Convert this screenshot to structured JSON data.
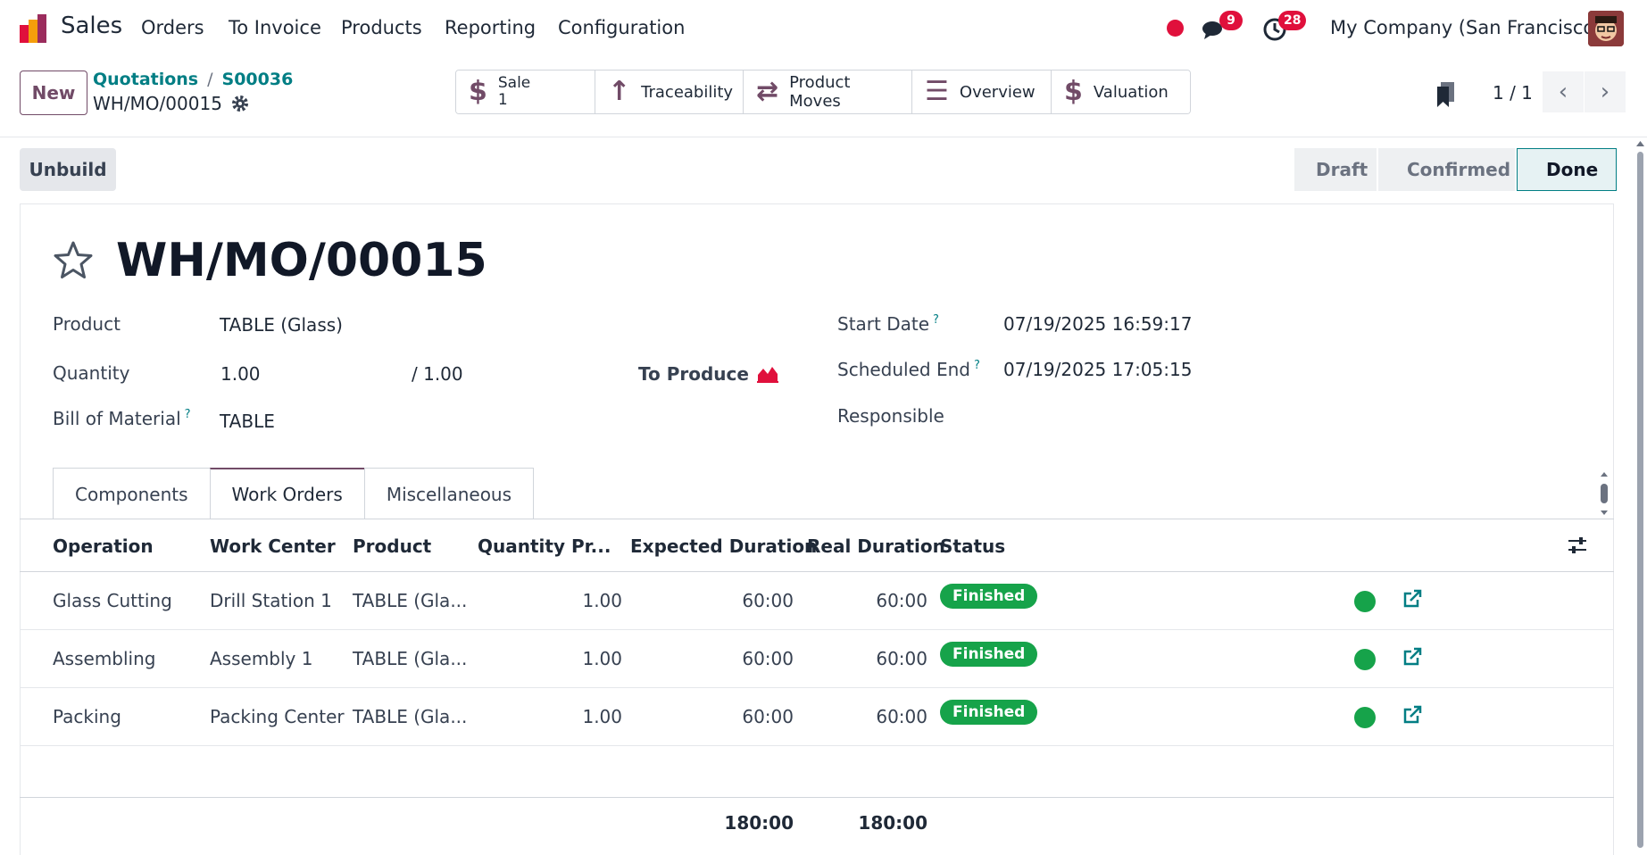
{
  "nav": {
    "app_name": "Sales",
    "menu": [
      "Orders",
      "To Invoice",
      "Products",
      "Reporting",
      "Configuration"
    ],
    "messages_count": "9",
    "activities_count": "28",
    "company": "My Company (San Francisco)"
  },
  "control": {
    "new_label": "New",
    "breadcrumb": [
      "Quotations",
      "S00036"
    ],
    "record_name": "WH/MO/00015",
    "smart_buttons": {
      "sale_label": "Sale",
      "sale_count": "1",
      "traceability": "Traceability",
      "product_moves": "Product Moves",
      "overview": "Overview",
      "valuation": "Valuation"
    },
    "pager": "1 / 1"
  },
  "status": {
    "unbuild_label": "Unbuild",
    "stages": [
      "Draft",
      "Confirmed",
      "Done"
    ],
    "active_stage": "Done"
  },
  "form": {
    "title": "WH/MO/00015",
    "product_label": "Product",
    "product_value": "TABLE (Glass)",
    "quantity_label": "Quantity",
    "quantity_value": "1.00",
    "quantity_total": "/ 1.00",
    "to_produce_label": "To Produce",
    "bom_label": "Bill of Material",
    "bom_value": "TABLE",
    "start_date_label": "Start Date",
    "start_date_value": "07/19/2025 16:59:17",
    "scheduled_end_label": "Scheduled End",
    "scheduled_end_value": "07/19/2025 17:05:15",
    "responsible_label": "Responsible",
    "help_mark": "?"
  },
  "tabs": [
    "Components",
    "Work Orders",
    "Miscellaneous"
  ],
  "active_tab": "Work Orders",
  "work_orders": {
    "columns": [
      "Operation",
      "Work Center",
      "Product",
      "Quantity Pr...",
      "Expected Duration",
      "Real Duration",
      "Status"
    ],
    "rows": [
      {
        "operation": "Glass Cutting",
        "work_center": "Drill Station 1",
        "product": "TABLE (Gla...",
        "quantity": "1.00",
        "expected": "60:00",
        "real": "60:00",
        "status": "Finished"
      },
      {
        "operation": "Assembling",
        "work_center": "Assembly 1",
        "product": "TABLE (Gla...",
        "quantity": "1.00",
        "expected": "60:00",
        "real": "60:00",
        "status": "Finished"
      },
      {
        "operation": "Packing",
        "work_center": "Packing Center",
        "product": "TABLE (Gla...",
        "quantity": "1.00",
        "expected": "60:00",
        "real": "60:00",
        "status": "Finished"
      }
    ],
    "total_expected": "180:00",
    "total_real": "180:00"
  },
  "colors": {
    "brand": "#714b67",
    "link": "#017e84",
    "badge": "#e0103c",
    "success": "#16a34a"
  }
}
